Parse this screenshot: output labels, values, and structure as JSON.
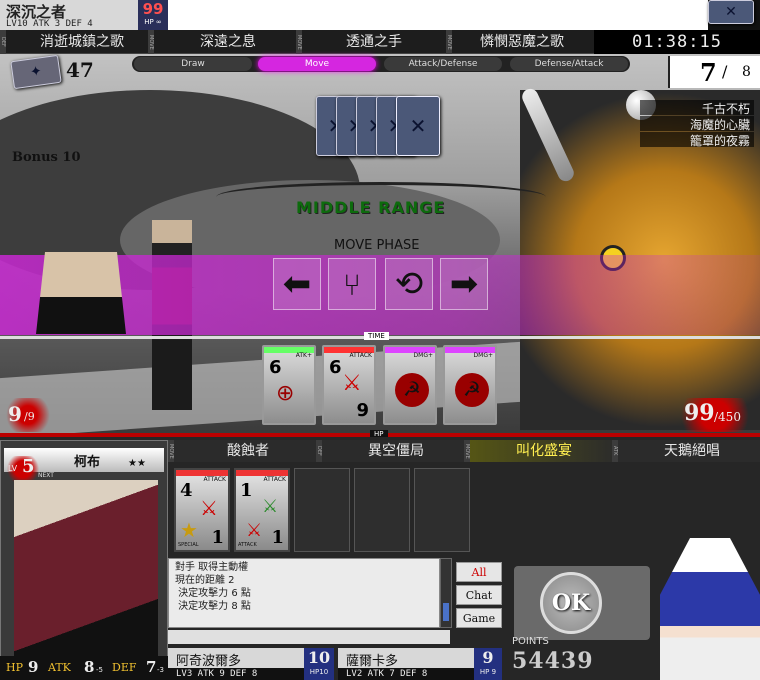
{
  "enemy": {
    "name": "深沉之者",
    "stats_line": "LV10 ATK 3 DEF 4",
    "hp": "99",
    "hp_max": "HP ∞",
    "skills": [
      "消逝城鎮之歌",
      "深遠之息",
      "透通之手",
      "憐憫惡魔之歌"
    ],
    "tags": [
      "DEF",
      "MOVE",
      "MOVE",
      "MOVE"
    ],
    "deck_count": "47",
    "bonus": "Bonus 10",
    "life_current": "99",
    "life_max": "/450",
    "abilities": [
      "千古不朽",
      "海魔的心臟",
      "籠罩的夜霧"
    ]
  },
  "clock": "01:38:15",
  "turn": {
    "current": "7",
    "sep": "/",
    "max": "8"
  },
  "phases": [
    {
      "label": "Draw",
      "active": false
    },
    {
      "label": "Move",
      "active": true
    },
    {
      "label": "Attack/Defense",
      "active": false
    },
    {
      "label": "Defense/Attack",
      "active": false
    }
  ],
  "range_label": "MIDDLE RANGE",
  "phase_title": "MOVE PHASE",
  "time_label": "TIME",
  "hp_label": "HP",
  "player_life": {
    "current": "9",
    "max": "/9"
  },
  "move_buttons": [
    "arrow-left-icon",
    "chair-icon",
    "rotate-icon",
    "arrow-right-icon"
  ],
  "enemy_cards": [
    {
      "strip": "#6f6",
      "label": "ATK+",
      "top": "6",
      "bottom": "",
      "icon": "crosshair"
    },
    {
      "strip": "#f33",
      "label": "ATTACK",
      "top": "6",
      "bottom": "9",
      "icon": "sword"
    },
    {
      "strip": "#d4f",
      "label": "DMG+",
      "top": "",
      "bottom": "",
      "icon": "eye-seal"
    },
    {
      "strip": "#d4f",
      "label": "DMG+",
      "top": "",
      "bottom": "",
      "icon": "eye-seal"
    }
  ],
  "player": {
    "level": "5",
    "lv_label": "LV",
    "next": "NEXT",
    "name": "柯布",
    "stars": "★★",
    "hp_label": "HP",
    "hp": "9",
    "atk_label": "ATK",
    "atk": "8",
    "atk_sub": "-5",
    "def_label": "DEF",
    "def": "7",
    "def_sub": "-3",
    "skills": [
      "酸蝕者",
      "異空僵局",
      "叫化盛宴",
      "天鵝絕唱"
    ],
    "skill_tags": [
      "MOVE",
      "DEF",
      "MOVE",
      "ATK"
    ],
    "highlight_skill": "叫化盛宴",
    "cards": [
      {
        "top": "4",
        "bottom": "1",
        "label": "ATTACK",
        "sub": "SPECIAL"
      },
      {
        "top": "1",
        "bottom": "1",
        "label": "ATTACK",
        "sub": "ATTACK"
      }
    ]
  },
  "log": [
    "對手 取得主動權",
    "現在的距離 2",
    " 決定攻擊力 6 點",
    " 決定攻擊力 8 點"
  ],
  "side_buttons": [
    "All",
    "Chat",
    "Game"
  ],
  "ok_label": "OK",
  "points_label": "POINTS",
  "points": "54439",
  "allies": [
    {
      "name": "阿奇波爾多",
      "stats": "LV3 ATK 9 DEF 8",
      "hp": "10",
      "hp_label": "HP10"
    },
    {
      "name": "薩爾卡多",
      "stats": "LV2 ATK 7 DEF 8",
      "hp": "9",
      "hp_label": "HP 9"
    }
  ]
}
